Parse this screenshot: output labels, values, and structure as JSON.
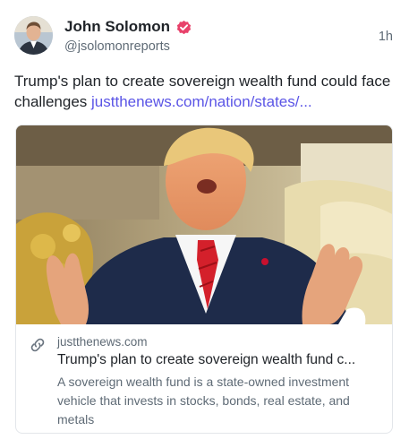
{
  "author": {
    "display_name": "John Solomon",
    "handle": "@jsolomonreports",
    "avatar_icon": "avatar-photo",
    "verified_icon": "verified-badge-icon"
  },
  "post": {
    "time": "1h",
    "text": "Trump's plan to create sovereign wealth fund could face challenges ",
    "link_text": "justthenews.com/nation/states/..."
  },
  "link_card": {
    "image": "photo of Trump speaking with hands raised",
    "domain": "justthenews.com",
    "title": "Trump's plan to create sovereign wealth fund c...",
    "description": "A sovereign wealth fund is a state-owned investment vehicle that invests in stocks, bonds, real estate, and metals",
    "link_icon": "link-chain-icon"
  },
  "colors": {
    "accent": "#5b55e6",
    "verified": "#e8416a",
    "muted_text": "#5f6b76",
    "tie_red": "#d4202b",
    "suit_navy": "#1e2b4a"
  }
}
